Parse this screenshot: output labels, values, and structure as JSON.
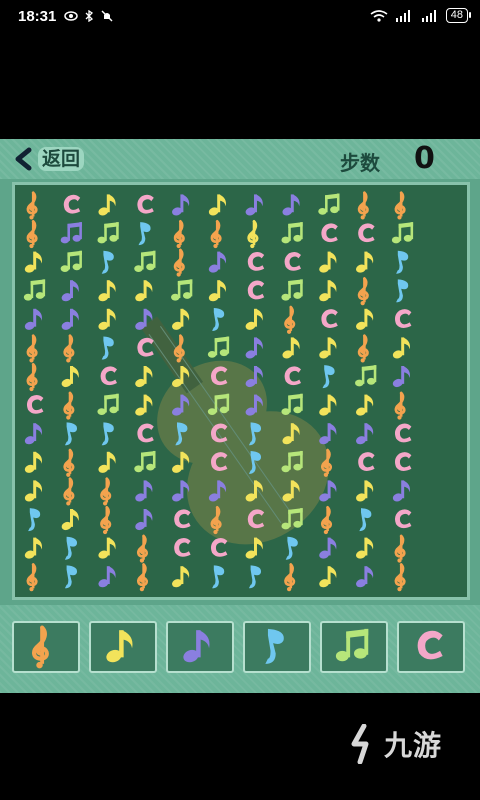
{
  "status_bar": {
    "time": "18:31",
    "left_icons": [
      "eye-icon",
      "bluetooth-icon",
      "mute-icon"
    ],
    "right_icons": [
      "wifi-icon",
      "signal-icon-1",
      "signal-icon-2"
    ],
    "battery": "48"
  },
  "header": {
    "back_label": "返回",
    "steps_label": "步数",
    "steps_value": "0"
  },
  "colors": {
    "orange": "#f3a34e",
    "yellow": "#f2e35b",
    "pink": "#f4a7c8",
    "blue": "#6fc7ef",
    "purple": "#8a7fe0",
    "green": "#b6e67a"
  },
  "symbols": {
    "T": "treble-clef",
    "E": "eighth-note",
    "Q": "beamed-notes",
    "C": "c-symbol",
    "F": "flat-note"
  },
  "board": {
    "rows": [
      "OT PC YE PC PE YE PE PE GQ OT OT",
      "OT PQ GQ BF OT OT YT GQ PC PC GQ",
      "YE GQ BF GQ OT PE PC PC YE YE BF",
      "GQ PE YE YE GQ YE PC GQ YE OT BF",
      "PE PE YE PE YE BF YE OT PC YE PC",
      "OT OT BF PC OT GQ PE YE YE OT YE",
      "OT YE PC YE YE PC PE PC BF GQ PE",
      "PC OT GQ YE PE GQ PE GQ YE YE OT",
      "PE BF BF PC BF PC BF YE PE PE PC",
      "YE OT YE GQ YE PC BF GQ OT PC PC",
      "YE OT OT PE PE PE YE YE PE YE PE",
      "BF YE OT PE PC OT PC GQ OT BF PC",
      "YE BF YE OT PC PC YE BF PE YE OT",
      "OT BF PE OT YE BF BF OT YE PE OT"
    ],
    "background_art": "violin-icon"
  },
  "picker": [
    {
      "name": "picker-orange-treble-clef",
      "sym": "T",
      "color": "orange"
    },
    {
      "name": "picker-yellow-eighth-note",
      "sym": "E",
      "color": "yellow"
    },
    {
      "name": "picker-purple-eighth-note",
      "sym": "E",
      "color": "purple"
    },
    {
      "name": "picker-blue-flat-note",
      "sym": "F",
      "color": "blue"
    },
    {
      "name": "picker-green-beamed-notes",
      "sym": "Q",
      "color": "green"
    },
    {
      "name": "picker-pink-c-symbol",
      "sym": "C",
      "color": "pink"
    }
  ],
  "watermark": {
    "text": "九游",
    "icon": "jiuyou-logo-icon"
  }
}
